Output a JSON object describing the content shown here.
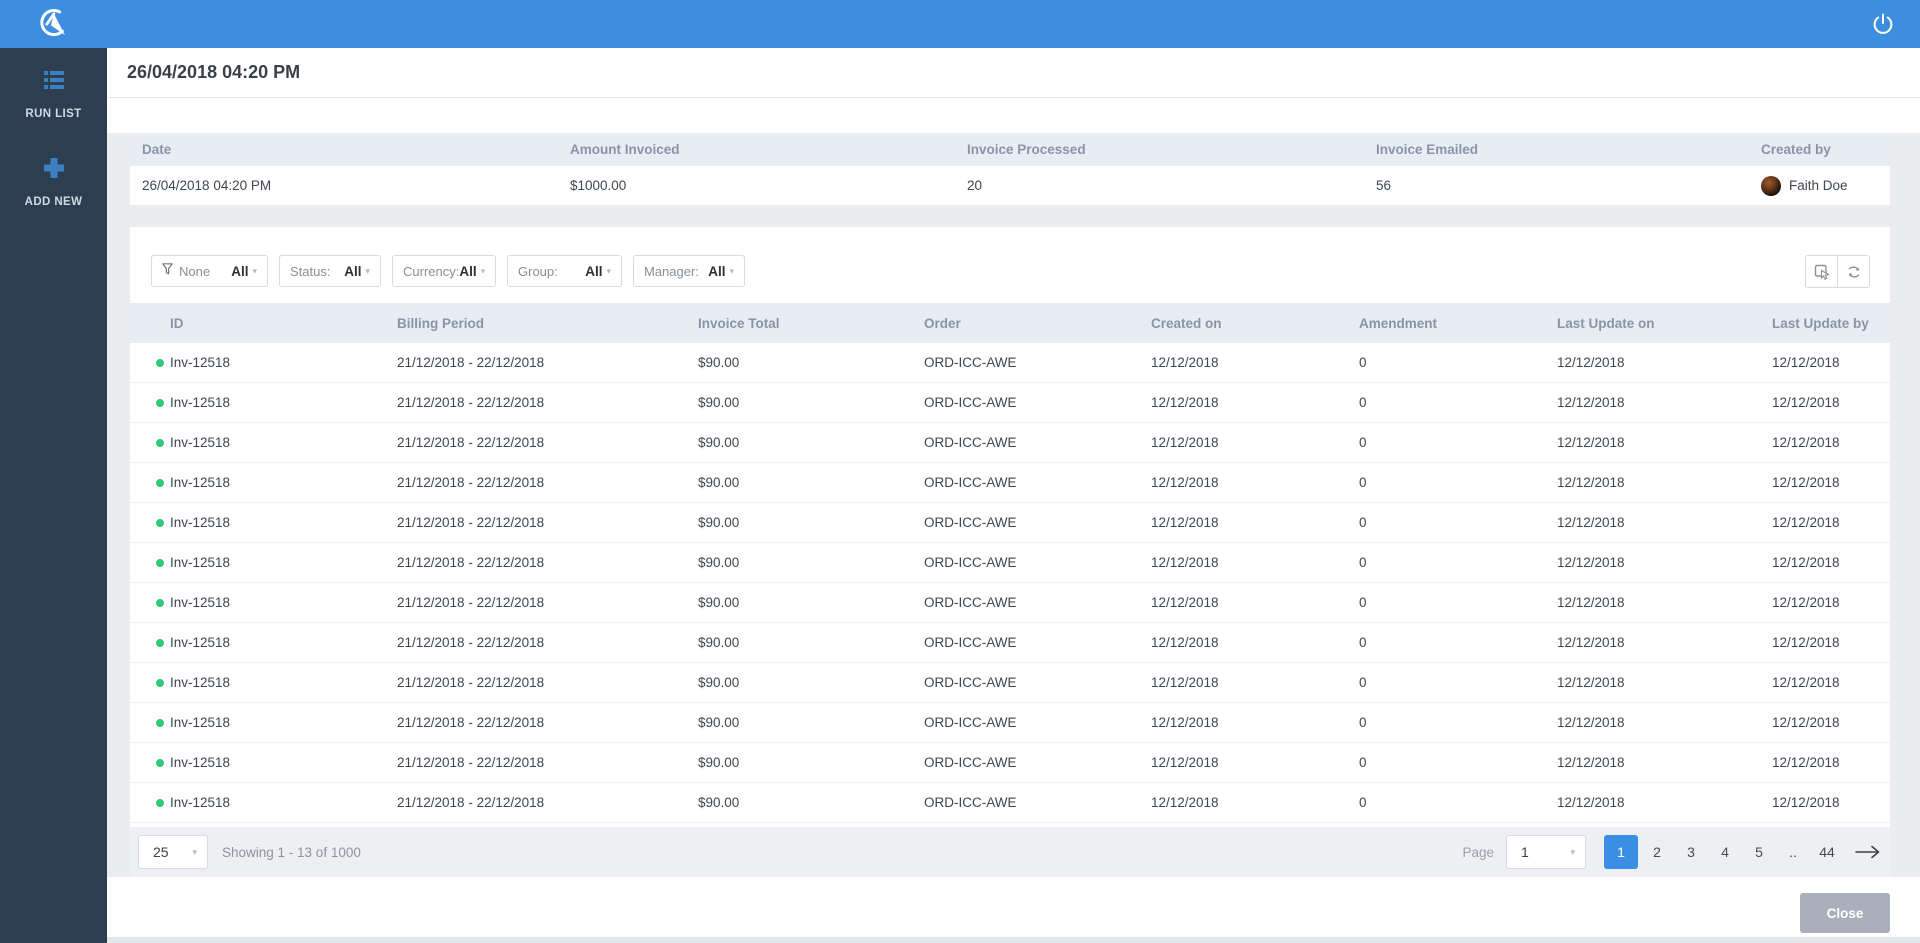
{
  "topbar": {
    "power_icon": "power-icon"
  },
  "sidebar": {
    "items": [
      {
        "label": "RUN LIST",
        "icon": "run-list-icon"
      },
      {
        "label": "ADD NEW",
        "icon": "add-new-icon"
      }
    ]
  },
  "header": {
    "title": "26/04/2018 04:20 PM"
  },
  "summary_table": {
    "columns": [
      "Date",
      "Amount Invoiced",
      "Invoice Processed",
      "Invoice Emailed",
      "Created by"
    ],
    "row": {
      "date": "26/04/2018 04:20 PM",
      "amount_invoiced": "$1000.00",
      "invoice_processed": "20",
      "invoice_emailed": "56",
      "created_by": "Faith Doe"
    }
  },
  "filters": [
    {
      "label": "None",
      "value": "All",
      "funnel_icon": true
    },
    {
      "label": "Status:",
      "value": "All",
      "funnel_icon": false
    },
    {
      "label": "Currency:",
      "value": "All",
      "funnel_icon": false
    },
    {
      "label": "Group:",
      "value": "All",
      "funnel_icon": false
    },
    {
      "label": "Manager:",
      "value": "All",
      "funnel_icon": false
    }
  ],
  "toolbar_icons": [
    "select-cursor-icon",
    "refresh-icon"
  ],
  "invoice_table": {
    "columns": [
      "ID",
      "Billing Period",
      "Invoice Total",
      "Order",
      "Created on",
      "Amendment",
      "Last Update on",
      "Last Update by"
    ],
    "row_count": 12,
    "rows": [
      {
        "id": "Inv-12518",
        "billing_period": "21/12/2018 - 22/12/2018",
        "invoice_total": "$90.00",
        "order": "ORD-ICC-AWE",
        "created_on": "12/12/2018",
        "amendment": "0",
        "last_update_on": "12/12/2018",
        "last_update_by": "12/12/2018"
      },
      {
        "id": "Inv-12518",
        "billing_period": "21/12/2018 - 22/12/2018",
        "invoice_total": "$90.00",
        "order": "ORD-ICC-AWE",
        "created_on": "12/12/2018",
        "amendment": "0",
        "last_update_on": "12/12/2018",
        "last_update_by": "12/12/2018"
      },
      {
        "id": "Inv-12518",
        "billing_period": "21/12/2018 - 22/12/2018",
        "invoice_total": "$90.00",
        "order": "ORD-ICC-AWE",
        "created_on": "12/12/2018",
        "amendment": "0",
        "last_update_on": "12/12/2018",
        "last_update_by": "12/12/2018"
      },
      {
        "id": "Inv-12518",
        "billing_period": "21/12/2018 - 22/12/2018",
        "invoice_total": "$90.00",
        "order": "ORD-ICC-AWE",
        "created_on": "12/12/2018",
        "amendment": "0",
        "last_update_on": "12/12/2018",
        "last_update_by": "12/12/2018"
      },
      {
        "id": "Inv-12518",
        "billing_period": "21/12/2018 - 22/12/2018",
        "invoice_total": "$90.00",
        "order": "ORD-ICC-AWE",
        "created_on": "12/12/2018",
        "amendment": "0",
        "last_update_on": "12/12/2018",
        "last_update_by": "12/12/2018"
      },
      {
        "id": "Inv-12518",
        "billing_period": "21/12/2018 - 22/12/2018",
        "invoice_total": "$90.00",
        "order": "ORD-ICC-AWE",
        "created_on": "12/12/2018",
        "amendment": "0",
        "last_update_on": "12/12/2018",
        "last_update_by": "12/12/2018"
      },
      {
        "id": "Inv-12518",
        "billing_period": "21/12/2018 - 22/12/2018",
        "invoice_total": "$90.00",
        "order": "ORD-ICC-AWE",
        "created_on": "12/12/2018",
        "amendment": "0",
        "last_update_on": "12/12/2018",
        "last_update_by": "12/12/2018"
      },
      {
        "id": "Inv-12518",
        "billing_period": "21/12/2018 - 22/12/2018",
        "invoice_total": "$90.00",
        "order": "ORD-ICC-AWE",
        "created_on": "12/12/2018",
        "amendment": "0",
        "last_update_on": "12/12/2018",
        "last_update_by": "12/12/2018"
      },
      {
        "id": "Inv-12518",
        "billing_period": "21/12/2018 - 22/12/2018",
        "invoice_total": "$90.00",
        "order": "ORD-ICC-AWE",
        "created_on": "12/12/2018",
        "amendment": "0",
        "last_update_on": "12/12/2018",
        "last_update_by": "12/12/2018"
      },
      {
        "id": "Inv-12518",
        "billing_period": "21/12/2018 - 22/12/2018",
        "invoice_total": "$90.00",
        "order": "ORD-ICC-AWE",
        "created_on": "12/12/2018",
        "amendment": "0",
        "last_update_on": "12/12/2018",
        "last_update_by": "12/12/2018"
      },
      {
        "id": "Inv-12518",
        "billing_period": "21/12/2018 - 22/12/2018",
        "invoice_total": "$90.00",
        "order": "ORD-ICC-AWE",
        "created_on": "12/12/2018",
        "amendment": "0",
        "last_update_on": "12/12/2018",
        "last_update_by": "12/12/2018"
      },
      {
        "id": "Inv-12518",
        "billing_period": "21/12/2018 - 22/12/2018",
        "invoice_total": "$90.00",
        "order": "ORD-ICC-AWE",
        "created_on": "12/12/2018",
        "amendment": "0",
        "last_update_on": "12/12/2018",
        "last_update_by": "12/12/2018"
      }
    ]
  },
  "footer": {
    "page_size": "25",
    "showing_text": "Showing 1 - 13 of 1000",
    "page_label": "Page",
    "page_select_value": "1",
    "pages": [
      "1",
      "2",
      "3",
      "4",
      "5",
      "..",
      "44"
    ],
    "active_page": "1"
  },
  "close_button_label": "Close",
  "colors": {
    "topbar_blue": "#3e8ee0",
    "sidebar_dark": "#2d3e50",
    "sidebar_icon_blue": "#3a80c2",
    "header_band": "#e8ecf3",
    "status_dot_green": "#2bc97a",
    "active_page_blue": "#3a8fe4",
    "close_button_gray": "#a9b0bb",
    "page_background": "#eaecef"
  }
}
